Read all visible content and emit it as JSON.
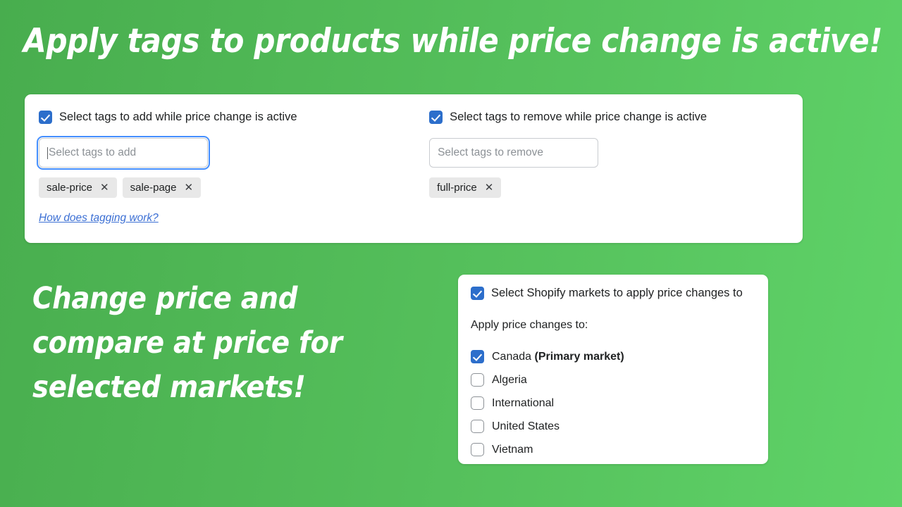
{
  "theme": {
    "background_green_dark": "#48ad4e",
    "background_green_light": "#5fd368",
    "accent_blue": "#2c6ecb",
    "link_blue": "#3b6fd4",
    "chip_gray": "#e8e8e8",
    "text_dark": "#202223"
  },
  "headlines": {
    "top": "Apply tags to products while price change is active!",
    "mid_line1": "Change price and",
    "mid_line2": "compare at price for",
    "mid_line3": "selected markets!"
  },
  "tags_card": {
    "add": {
      "checkbox_label": "Select tags to add while price change is active",
      "checkbox_checked": true,
      "input_placeholder": "Select tags to add",
      "input_value": "",
      "input_focused": true,
      "chips": [
        "sale-price",
        "sale-page"
      ],
      "remove_icon": "✕"
    },
    "remove": {
      "checkbox_label": "Select tags to remove while price change is active",
      "checkbox_checked": true,
      "input_placeholder": "Select tags to remove",
      "input_value": "",
      "input_focused": false,
      "chips": [
        "full-price"
      ],
      "remove_icon": "✕"
    },
    "help_link": "How does tagging work?"
  },
  "markets_card": {
    "checkbox_label": "Select Shopify markets to apply price changes to",
    "checkbox_checked": true,
    "subtitle": "Apply price changes to:",
    "markets": [
      {
        "name": "Canada",
        "suffix": "(Primary market)",
        "checked": true
      },
      {
        "name": "Algeria",
        "suffix": "",
        "checked": false
      },
      {
        "name": "International",
        "suffix": "",
        "checked": false
      },
      {
        "name": "United States",
        "suffix": "",
        "checked": false
      },
      {
        "name": "Vietnam",
        "suffix": "",
        "checked": false
      }
    ]
  }
}
